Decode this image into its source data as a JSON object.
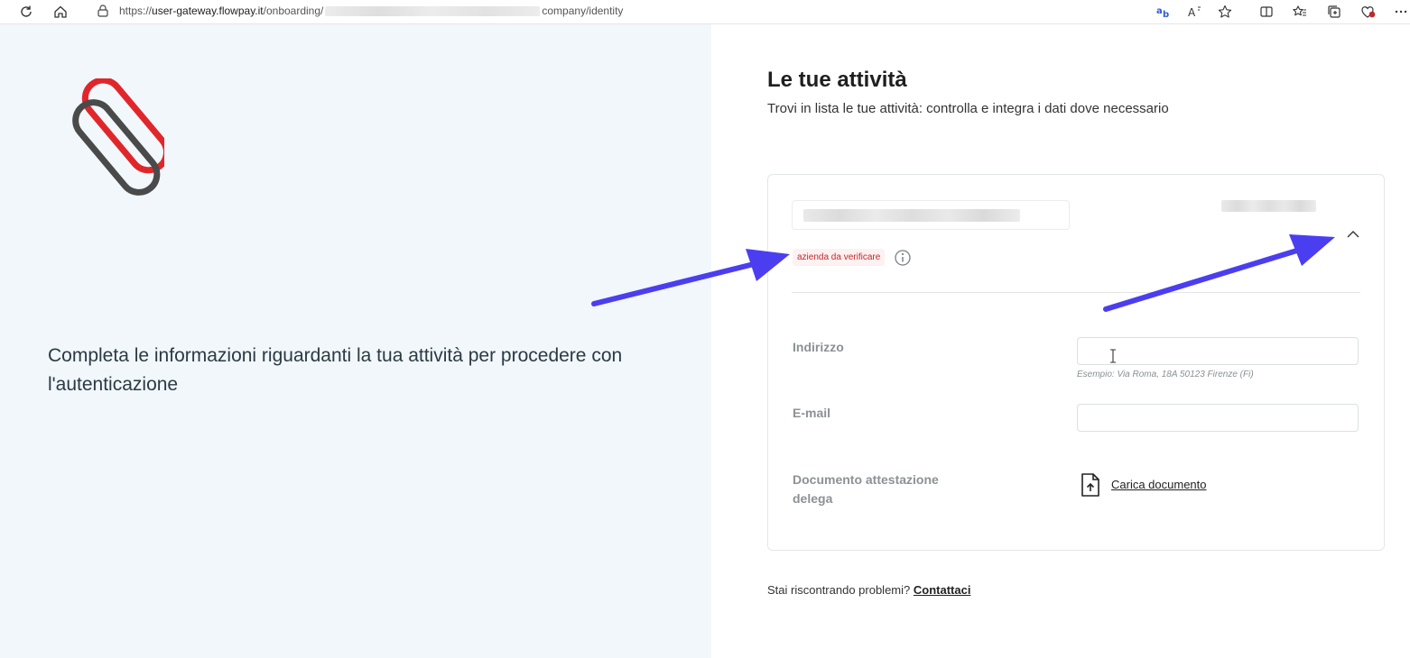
{
  "browser": {
    "url_prefix": "https://",
    "url_host": "user-gateway.flowpay.it",
    "url_path_start": "/onboarding/",
    "url_path_end": "company/identity"
  },
  "left": {
    "message": "Completa le informazioni riguardanti la tua attività per procedere con l'autenticazione"
  },
  "main": {
    "title": "Le tue attività",
    "subtitle": "Trovi in lista le tue attività: controlla e integra i dati dove necessario",
    "card": {
      "status_badge": "azienda da verificare",
      "fields": {
        "address_label": "Indirizzo",
        "address_value": "",
        "address_hint": "Esempio: Via Roma, 18A 50123 Firenze (Fi)",
        "email_label": "E-mail",
        "email_value": "",
        "document_label_line1": "Documento attestazione",
        "document_label_line2": "delega",
        "upload_link": "Carica documento"
      }
    },
    "footer": {
      "question": "Stai riscontrando problemi?",
      "contact_link": "Contattaci"
    }
  },
  "colors": {
    "left_bg": "#f1f7fa",
    "badge_text": "#c22a2a",
    "badge_bg": "#fdf1f1",
    "logo_red": "#e0262a",
    "logo_gray": "#4a4a4a",
    "annotation_arrow": "#4b3ef0"
  },
  "icons": {
    "reload": "reload-icon",
    "home": "home-icon",
    "lock": "lock-icon",
    "translate": "translate-icon",
    "read_aloud": "read-aloud-icon",
    "favorite": "star-icon",
    "split": "split-screen-icon",
    "favorites": "favorites-icon",
    "collections": "collections-icon",
    "extension": "heart-badge-icon",
    "more": "more-icon",
    "info": "info-icon",
    "chevron": "chevron-up-icon",
    "document": "upload-document-icon"
  }
}
